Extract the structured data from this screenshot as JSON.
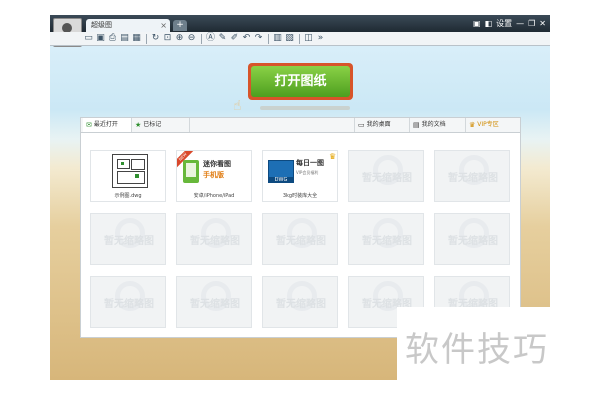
{
  "window": {
    "tab_title": "超级图",
    "tab_close": "×",
    "new_tab": "+",
    "controls": [
      "▣",
      "◧",
      "设置",
      "—",
      "❐",
      "✕"
    ]
  },
  "toolbar": {
    "icons": [
      "open-icon",
      "save-icon",
      "print-icon",
      "save-as-icon",
      "export-icon",
      "rotate-icon",
      "zoom-extents-icon",
      "zoom-in-icon",
      "zoom-out-icon",
      "text-icon",
      "pencil-icon",
      "annotate-icon",
      "undo-icon",
      "redo-icon",
      "layout-icon",
      "layers-icon",
      "measure-icon",
      "expand-icon"
    ]
  },
  "main": {
    "open_button": "打开图纸"
  },
  "panel": {
    "tabs": [
      {
        "label": "最近打开",
        "icon": "envelope-icon"
      },
      {
        "label": "已标记",
        "icon": "star-icon"
      },
      {
        "label": "我的桌面",
        "icon": "desktop-icon"
      },
      {
        "label": "我的文档",
        "icon": "document-icon"
      },
      {
        "label": "VIP专区",
        "icon": "vip-badge-icon"
      }
    ],
    "items": [
      {
        "caption": "示例图.dwg"
      },
      {
        "line1": "迷你看图",
        "line2": "手机版",
        "ribbon": "NEW",
        "caption": "安卓/iPhone/iPad"
      },
      {
        "badge": "DWG",
        "line1": "每日一图",
        "line2": "VIP会员福利",
        "caption": "3kg时装库大全"
      }
    ],
    "watermark": "暂无缩略图"
  },
  "overlay": {
    "text": "软件技巧"
  },
  "colors": {
    "open_button": "#5aa82b",
    "open_button_border": "#d7542a",
    "vip": "#d08a00"
  }
}
